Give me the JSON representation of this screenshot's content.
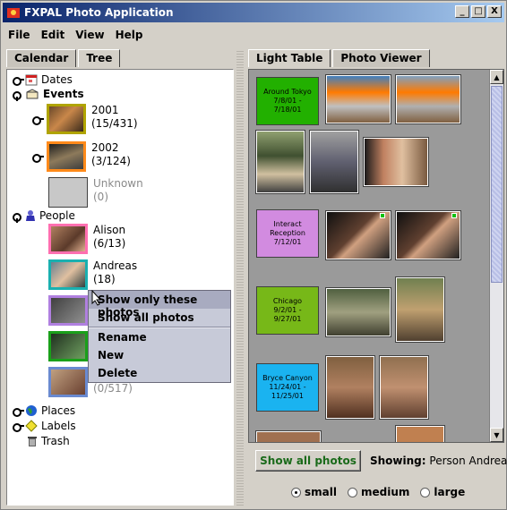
{
  "window": {
    "title": "FXPAL Photo Application",
    "minimize": "_",
    "maximize": "□",
    "close": "X"
  },
  "menu": [
    "File",
    "Edit",
    "View",
    "Help"
  ],
  "left_tabs": [
    "Calendar",
    "Tree"
  ],
  "tree": {
    "dates": "Dates",
    "events": "Events",
    "event_items": [
      {
        "year": "2001",
        "count": "(15/431)"
      },
      {
        "year": "2002",
        "count": "(3/124)"
      },
      {
        "year": "Unknown",
        "count": "(0)"
      }
    ],
    "people": "People",
    "people_items": [
      {
        "name": "Alison",
        "count": "(6/13)"
      },
      {
        "name": "Andreas",
        "count": "(18)"
      },
      {
        "name": "",
        "count": "(0/517)"
      }
    ],
    "places": "Places",
    "labels": "Labels",
    "trash": "Trash"
  },
  "context_menu": [
    "Show only these photos",
    "Show all photos",
    "Rename",
    "New",
    "Delete"
  ],
  "right_tabs": [
    "Light Table",
    "Photo Viewer"
  ],
  "groups": [
    {
      "title": "Around Tokyo",
      "dates": "7/8/01 - 7/18/01",
      "color": "#22b000"
    },
    {
      "title": "Interact Reception",
      "dates": "7/12/01",
      "color": "#d28be0"
    },
    {
      "title": "Chicago",
      "dates": "9/2/01 - 9/27/01",
      "color": "#77b818"
    },
    {
      "title": "Bryce Canyon",
      "dates": "11/24/01 - 11/25/01",
      "color": "#1ab3f0"
    }
  ],
  "bottom": {
    "show_all": "Show all photos",
    "showing_label": "Showing:",
    "showing_value": "Person Andreas",
    "sizes": [
      "small",
      "medium",
      "large"
    ],
    "selected_size": "small"
  }
}
